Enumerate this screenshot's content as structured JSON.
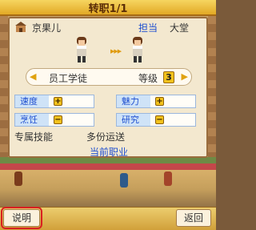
{
  "title": "转职1/1",
  "staff": {
    "name": "京果儿",
    "role": "担当",
    "location": "大堂"
  },
  "job": {
    "name": "员工学徒",
    "level_label": "等级",
    "level": "3"
  },
  "stats": {
    "speed": {
      "label": "速度",
      "change": "+"
    },
    "charm": {
      "label": "魅力",
      "change": "+"
    },
    "cooking": {
      "label": "烹饪",
      "change": "−"
    },
    "research": {
      "label": "研究",
      "change": "−"
    }
  },
  "skill": {
    "label": "专属技能",
    "value": "多份运送"
  },
  "current_job_label": "当前职业",
  "buttons": {
    "help": "说明",
    "back": "返回"
  },
  "icons": {
    "nav_left": "left-arrow-icon",
    "nav_right": "right-arrow-icon",
    "building": "building-icon",
    "transfer": "transfer-arrows-icon"
  },
  "colors": {
    "accent_blue": "#1f4fd0",
    "gold": "#f2c21c",
    "panel": "#f3e8cf"
  }
}
